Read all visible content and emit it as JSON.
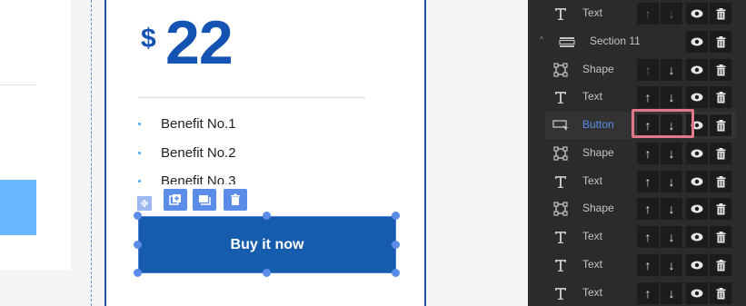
{
  "pricing": {
    "currency": "$",
    "amount": "22",
    "benefits": [
      "Benefit No.1",
      "Benefit No.2",
      "Benefit No.3"
    ],
    "cta_label": "Buy it now"
  },
  "element_toolbar": {
    "icons": [
      "duplicate-icon",
      "layer-icon",
      "trash-icon"
    ],
    "move_icon": "move-icon"
  },
  "layers_panel": {
    "rows": [
      {
        "type": "text",
        "label": "Text",
        "up_enabled": false,
        "down_enabled": false
      },
      {
        "type": "section",
        "label": "Section 11"
      },
      {
        "type": "shape",
        "label": "Shape",
        "up_enabled": false,
        "down_enabled": true
      },
      {
        "type": "text",
        "label": "Text",
        "up_enabled": true,
        "down_enabled": true
      },
      {
        "type": "button",
        "label": "Button",
        "up_enabled": true,
        "down_enabled": true,
        "selected": true
      },
      {
        "type": "shape",
        "label": "Shape",
        "up_enabled": true,
        "down_enabled": true
      },
      {
        "type": "text",
        "label": "Text",
        "up_enabled": true,
        "down_enabled": true
      },
      {
        "type": "shape",
        "label": "Shape",
        "up_enabled": true,
        "down_enabled": true
      },
      {
        "type": "text",
        "label": "Text",
        "up_enabled": true,
        "down_enabled": true
      },
      {
        "type": "text",
        "label": "Text",
        "up_enabled": true,
        "down_enabled": true
      },
      {
        "type": "text",
        "label": "Text",
        "up_enabled": true,
        "down_enabled": true
      }
    ],
    "up_glyph": "↑",
    "down_glyph": "↓"
  },
  "colors": {
    "accent": "#5b8ce8",
    "brand_blue": "#165cad",
    "highlight": "#e2778a",
    "panel_bg": "#2b2b2b"
  }
}
